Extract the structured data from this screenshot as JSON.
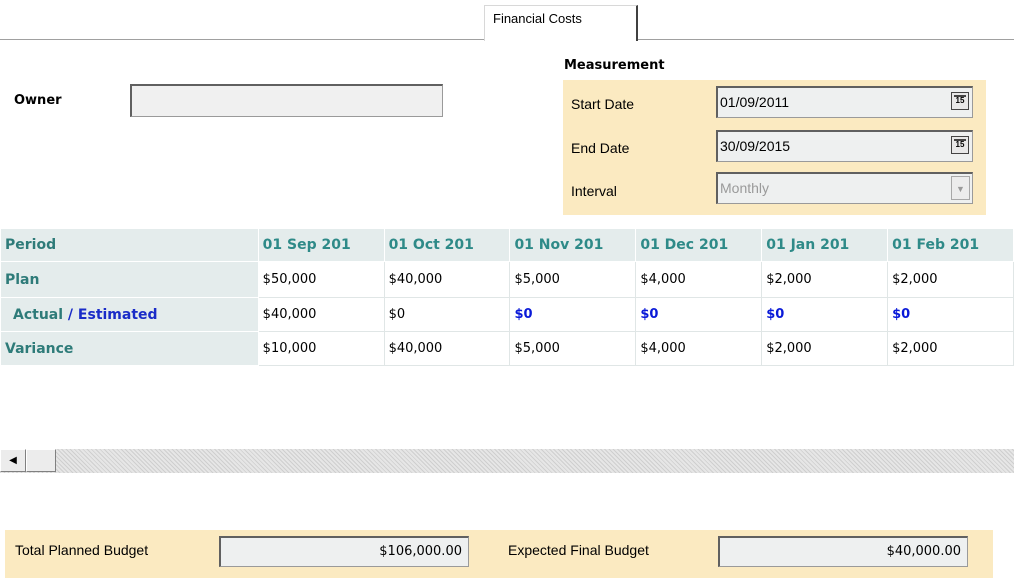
{
  "tab": {
    "label": "Financial Costs"
  },
  "owner": {
    "label": "Owner",
    "value": ""
  },
  "measurement": {
    "title": "Measurement",
    "start_date": {
      "label": "Start Date",
      "value": "01/09/2011"
    },
    "end_date": {
      "label": "End Date",
      "value": "30/09/2015"
    },
    "interval": {
      "label": "Interval",
      "value": "Monthly"
    },
    "calendar_icon_text": "15"
  },
  "grid": {
    "row_labels": {
      "period": "Period",
      "plan": "Plan",
      "actual": "Actual",
      "actual_sep": " / ",
      "estimated": "Estimated",
      "variance": "Variance"
    },
    "columns": [
      "01 Sep 201",
      "01 Oct 201",
      "01 Nov 201",
      "01 Dec 201",
      "01 Jan 201",
      "01 Feb 201"
    ],
    "plan": [
      "$50,000",
      "$40,000",
      "$5,000",
      "$4,000",
      "$2,000",
      "$2,000"
    ],
    "actual": [
      "$40,000",
      "$0",
      "$0",
      "$0",
      "$0",
      "$0"
    ],
    "variance": [
      "$10,000",
      "$40,000",
      "$5,000",
      "$4,000",
      "$2,000",
      "$2,000"
    ]
  },
  "scrollbar": {
    "left_arrow": "◀"
  },
  "budget": {
    "total_planned": {
      "label": "Total Planned Budget",
      "value": "$106,000.00"
    },
    "expected_final": {
      "label": "Expected Final Budget",
      "value": "$40,000.00"
    }
  },
  "colors": {
    "panel_bg": "#fbeac1",
    "grid_header_bg": "#e4ecec",
    "grid_header_text": "#2e7b79",
    "estimated_text": "#0a1ad8"
  }
}
